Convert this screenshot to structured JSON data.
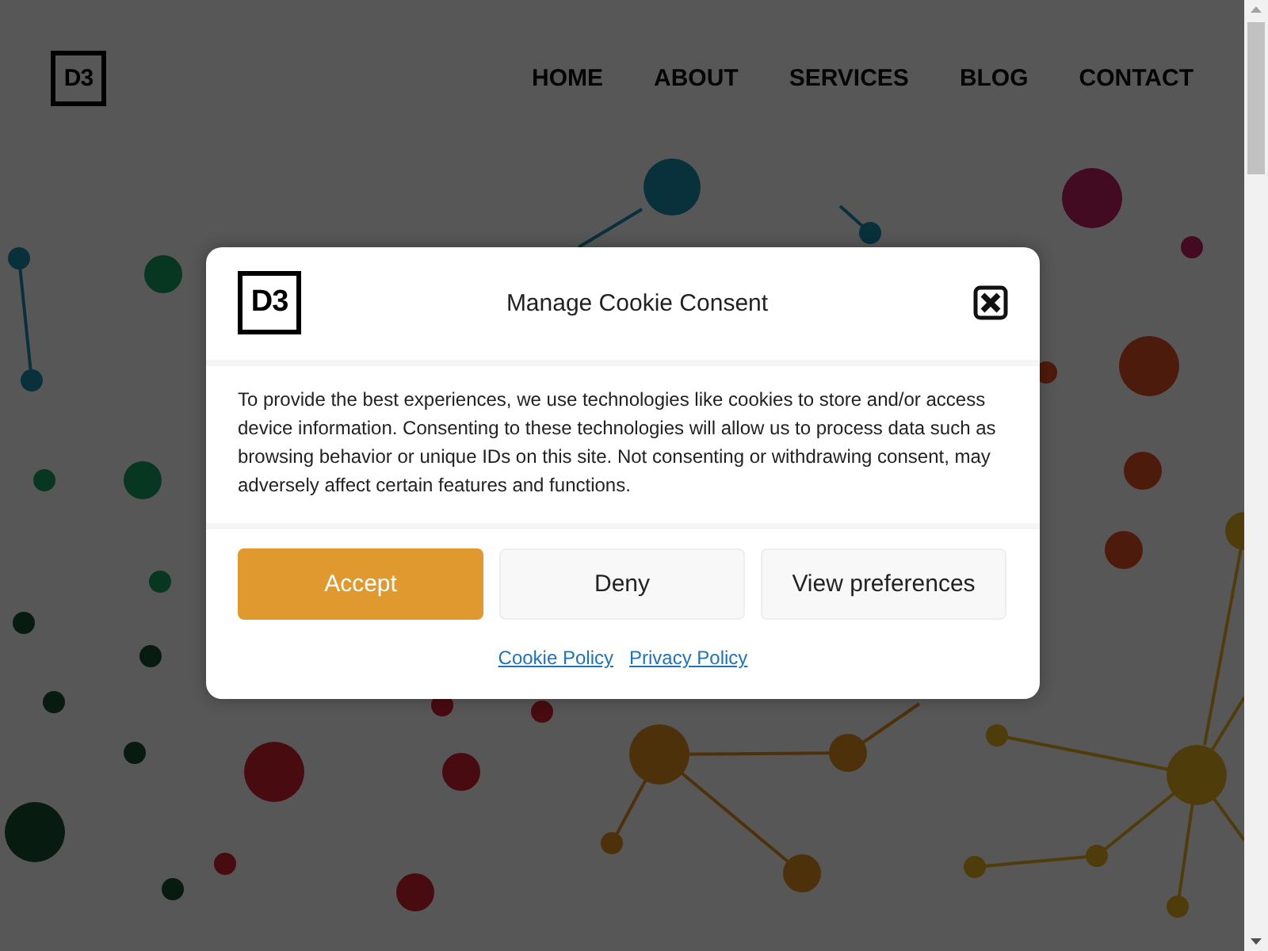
{
  "header": {
    "logo": {
      "text": "D3"
    },
    "nav": [
      {
        "label": "HOME"
      },
      {
        "label": "ABOUT"
      },
      {
        "label": "SERVICES"
      },
      {
        "label": "BLOG"
      },
      {
        "label": "CONTACT"
      }
    ]
  },
  "cookie_dialog": {
    "logo": {
      "text": "D3"
    },
    "title": "Manage Cookie Consent",
    "message": "To provide the best experiences, we use technologies like cookies to store and/or access device information. Consenting to these technologies will allow us to process data such as browsing behavior or unique IDs on this site. Not consenting or withdrawing consent, may adversely affect certain features and functions.",
    "buttons": [
      {
        "label": "Accept",
        "kind": "primary"
      },
      {
        "label": "Deny",
        "kind": "secondary"
      },
      {
        "label": "View preferences",
        "kind": "secondary"
      }
    ],
    "links": [
      "Cookie Policy",
      "Privacy Policy"
    ]
  }
}
